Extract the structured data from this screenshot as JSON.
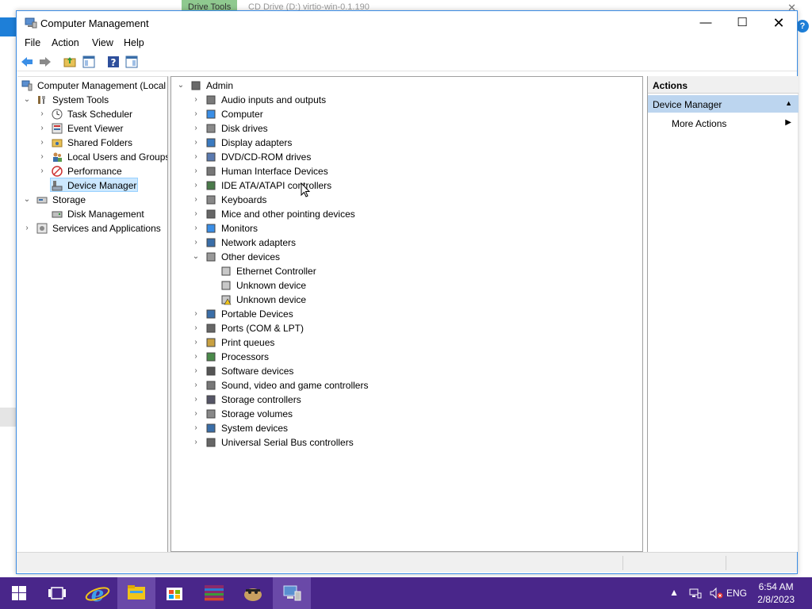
{
  "background_window": {
    "ribbon_tab": "Drive Tools",
    "title": "CD Drive (D:) virtio-win-0.1.190"
  },
  "window": {
    "title": "Computer Management",
    "controls": {
      "minimize": "—",
      "maximize": "☐",
      "close": "✕"
    }
  },
  "menu": [
    "File",
    "Action",
    "View",
    "Help"
  ],
  "toolbar": [
    "back-arrow-icon",
    "forward-arrow-icon",
    "up-folder-icon",
    "show-hide-tree-icon",
    "help-icon",
    "action-pane-icon"
  ],
  "left_tree": {
    "root": "Computer Management (Local",
    "system_tools": "System Tools",
    "items": [
      "Task Scheduler",
      "Event Viewer",
      "Shared Folders",
      "Local Users and Groups",
      "Performance",
      "Device Manager"
    ],
    "storage": "Storage",
    "storage_items": [
      "Disk Management"
    ],
    "services": "Services and Applications"
  },
  "device_tree": {
    "root": "Admin",
    "categories": [
      "Audio inputs and outputs",
      "Computer",
      "Disk drives",
      "Display adapters",
      "DVD/CD-ROM drives",
      "Human Interface Devices",
      "IDE ATA/ATAPI controllers",
      "Keyboards",
      "Mice and other pointing devices",
      "Monitors",
      "Network adapters",
      "Other devices"
    ],
    "other_devices": [
      "Ethernet Controller",
      "Unknown device",
      "Unknown device"
    ],
    "categories_after": [
      "Portable Devices",
      "Ports (COM & LPT)",
      "Print queues",
      "Processors",
      "Software devices",
      "Sound, video and game controllers",
      "Storage controllers",
      "Storage volumes",
      "System devices",
      "Universal Serial Bus controllers"
    ]
  },
  "actions": {
    "header": "Actions",
    "section": "Device Manager",
    "more": "More Actions"
  },
  "taskbar": {
    "lang": "ENG",
    "time": "6:54 AM",
    "date": "2/8/2023"
  },
  "colors": {
    "accent": "#3b8ce4",
    "taskbar": "#49268a",
    "selection": "#cce8ff",
    "action_section": "#bcd5ef"
  }
}
